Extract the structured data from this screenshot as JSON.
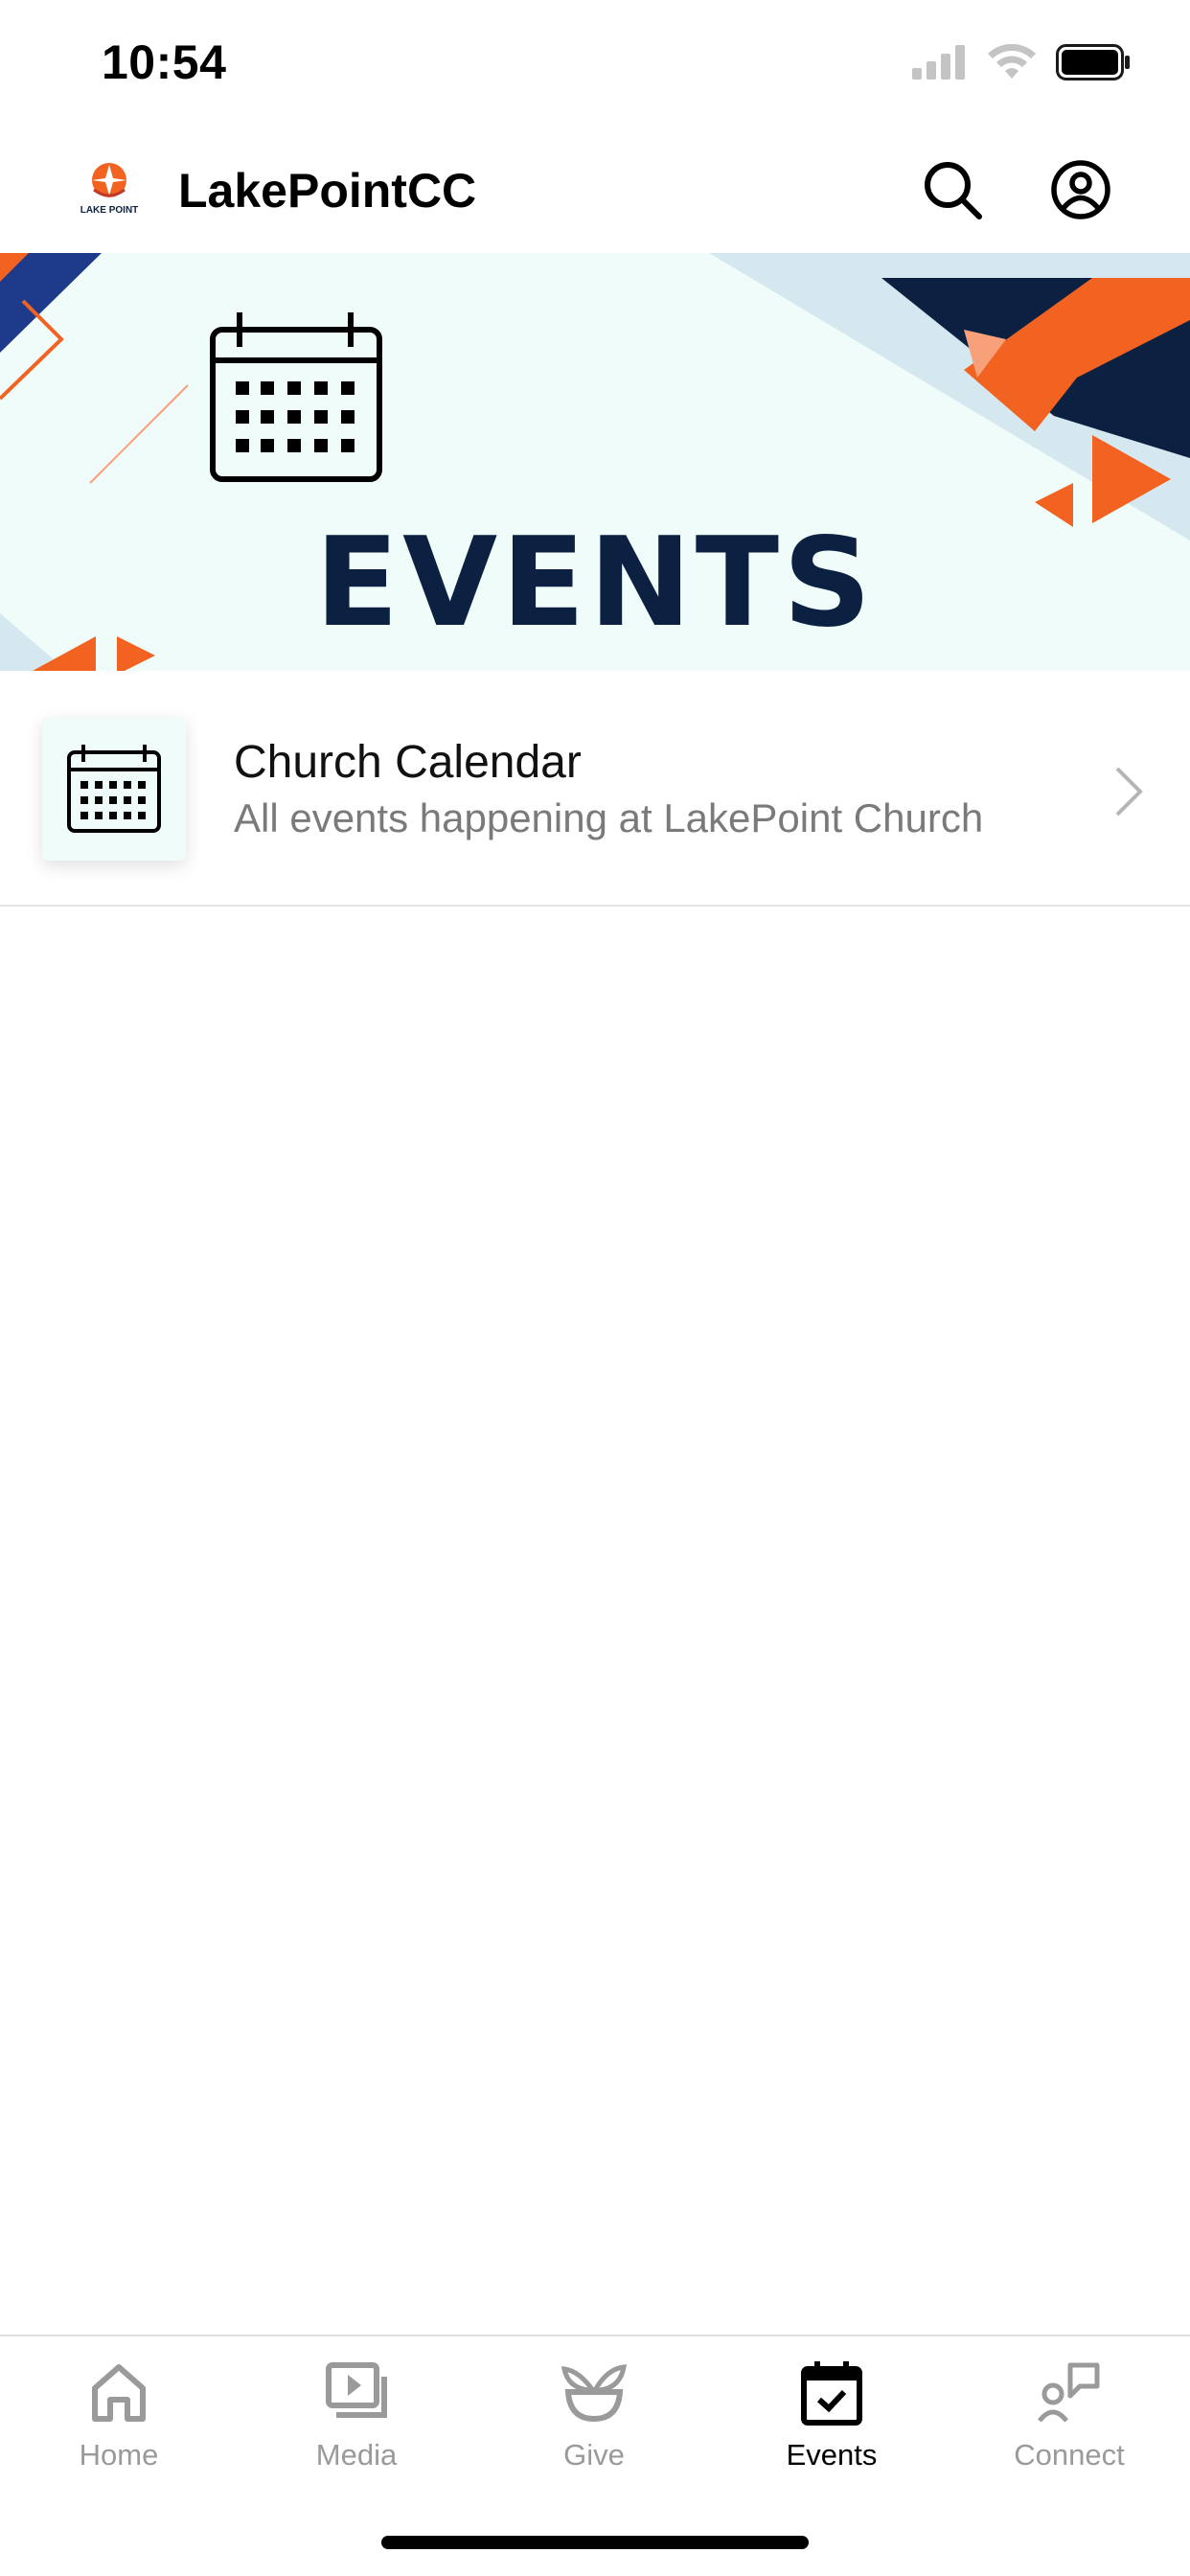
{
  "status_bar": {
    "time": "10:54"
  },
  "header": {
    "title": "LakePointCC",
    "logo_text": "LAKE POINT"
  },
  "banner": {
    "title": "EVENTS"
  },
  "list": [
    {
      "title": "Church Calendar",
      "subtitle": "All events happening at LakePoint Church"
    }
  ],
  "nav": {
    "items": [
      {
        "label": "Home",
        "icon": "home-icon"
      },
      {
        "label": "Media",
        "icon": "media-icon"
      },
      {
        "label": "Give",
        "icon": "give-icon"
      },
      {
        "label": "Events",
        "icon": "events-icon",
        "active": true
      },
      {
        "label": "Connect",
        "icon": "connect-icon"
      }
    ]
  },
  "colors": {
    "navy": "#0c2142",
    "orange": "#f26322",
    "banner_bg": "#effcf9",
    "inactive": "#9a9a9a"
  }
}
